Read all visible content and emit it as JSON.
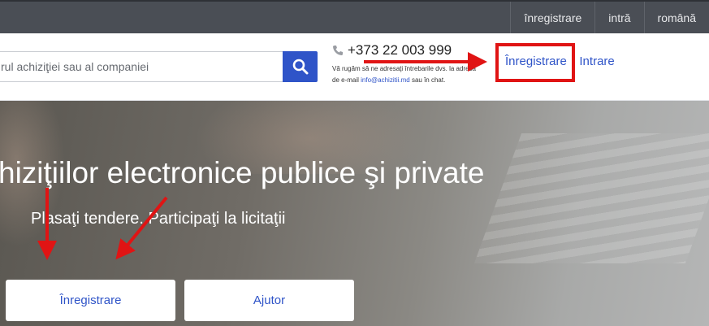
{
  "topbar": {
    "links": [
      "înregistrare",
      "intră",
      "română"
    ]
  },
  "search": {
    "placeholder": "rul achiziţiei sau al companiei"
  },
  "contact": {
    "phone": "+373 22 003 999",
    "note_line1": "Vă rugăm să ne adresaţi întrebarile dvs. la adresa",
    "note_line2_prefix": "de e-mail ",
    "email": "info@achizitii.md",
    "note_line2_suffix": " sau în chat."
  },
  "auth": {
    "register": "Înregistrare",
    "separator": "•",
    "login": "Intrare"
  },
  "hero": {
    "title": "hiziţiilor electronice publice şi private",
    "subtitle": "Plasaţi tendere. Participaţi la licitaţii",
    "register_button": "Înregistrare",
    "help_button": "Ajutor"
  },
  "colors": {
    "accent": "#2f54c8",
    "annotation": "#e01414",
    "topbar": "#4a4e55"
  },
  "icons": {
    "search": "search-icon",
    "phone": "phone-icon"
  }
}
